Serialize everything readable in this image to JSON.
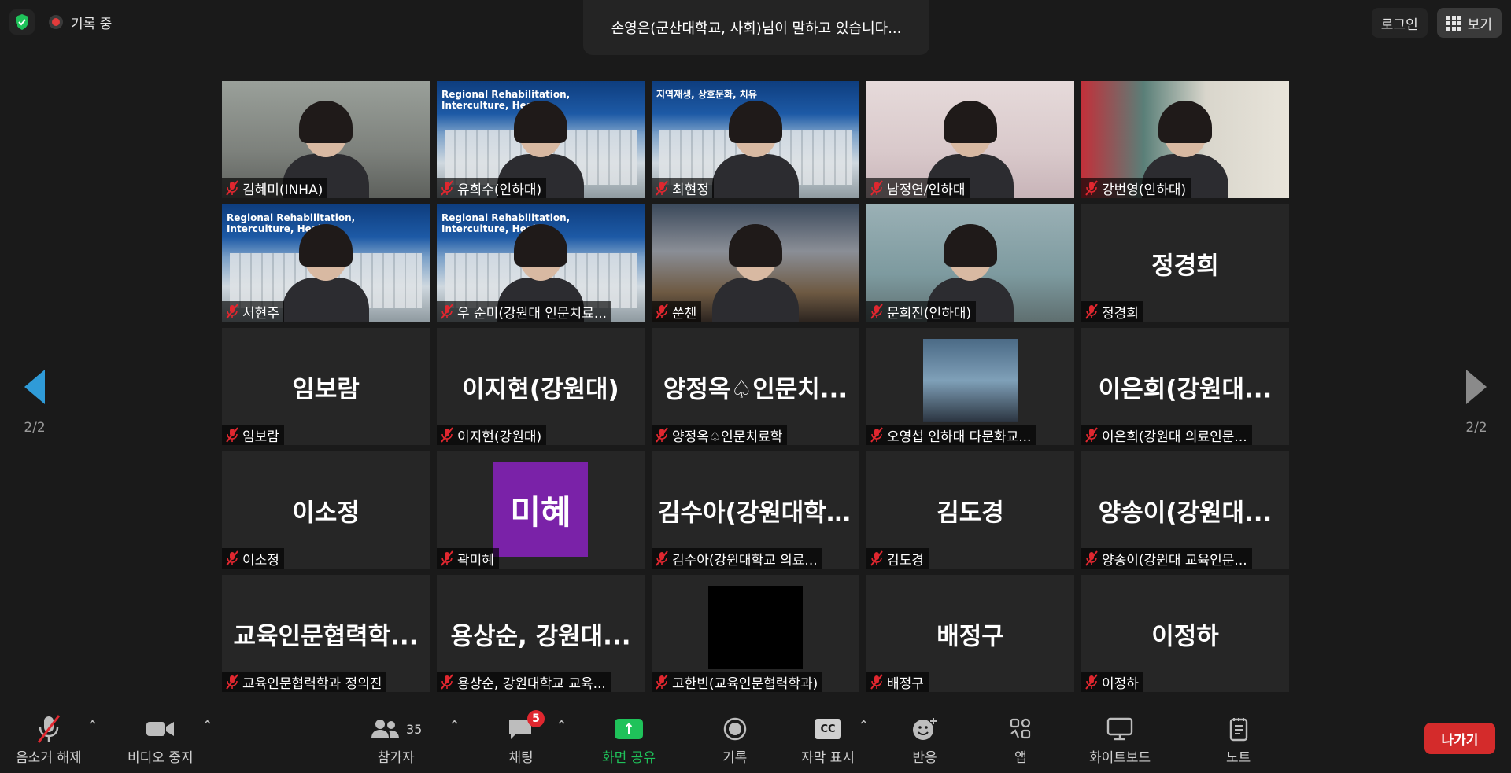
{
  "top": {
    "recording_label": "기록 중",
    "speaking_notice": "손영은(군산대학교, 사회)님이 말하고 있습니다...",
    "login_label": "로그인",
    "view_label": "보기"
  },
  "pagination": {
    "left": "2/2",
    "right": "2/2"
  },
  "tiles": [
    {
      "name": "김혜미(INHA)",
      "big": ""
    },
    {
      "name": "유희수(인하대)",
      "big": "",
      "slide": "Regional Rehabilitation,\nInterculture, Healing"
    },
    {
      "name": "최현정",
      "big": "",
      "slide": "지역재생, 상호문화, 치유"
    },
    {
      "name": "남정연/인하대",
      "big": ""
    },
    {
      "name": "강번영(인하대)",
      "big": ""
    },
    {
      "name": "서현주",
      "big": "",
      "slide": "Regional Rehabilitation,\nInterculture, Healing"
    },
    {
      "name": "우 순미(강원대 인문치료...",
      "big": "",
      "slide": "Regional Rehabilitation,\nInterculture, Healing"
    },
    {
      "name": "쑨첸",
      "big": ""
    },
    {
      "name": "문희진(인하대)",
      "big": ""
    },
    {
      "name": "정경희",
      "big": "정경희"
    },
    {
      "name": "임보람",
      "big": "임보람"
    },
    {
      "name": "이지현(강원대)",
      "big": "이지현(강원대)"
    },
    {
      "name": "양정옥♤인문치료학",
      "big": "양정옥♤인문치..."
    },
    {
      "name": "오영섭 인하대 다문화교...",
      "big": ""
    },
    {
      "name": "이은희(강원대 의료인문...",
      "big": "이은희(강원대..."
    },
    {
      "name": "이소정",
      "big": "이소정"
    },
    {
      "name": "곽미혜",
      "big": "",
      "avatar": "미혜"
    },
    {
      "name": "김수아(강원대학교 의료...",
      "big": "김수아(강원대학..."
    },
    {
      "name": "김도경",
      "big": "김도경"
    },
    {
      "name": "양송이(강원대 교육인문...",
      "big": "양송이(강원대..."
    },
    {
      "name": "교육인문협력학과 정의진",
      "big": "교육인문협력학..."
    },
    {
      "name": "용상순, 강원대학교 교육...",
      "big": "용상순, 강원대..."
    },
    {
      "name": "고한빈(교육인문협력학과)",
      "big": ""
    },
    {
      "name": "배정구",
      "big": "배정구"
    },
    {
      "name": "이정하",
      "big": "이정하"
    }
  ],
  "toolbar": {
    "unmute": "음소거 해제",
    "stop_video": "비디오 중지",
    "participants": "참가자",
    "participants_count": "35",
    "chat": "채팅",
    "chat_badge": "5",
    "share_screen": "화면 공유",
    "record": "기록",
    "captions": "자막 표시",
    "captions_icon": "CC",
    "reactions": "반응",
    "apps": "앱",
    "whiteboard": "화이트보드",
    "notes": "노트",
    "leave": "나가기"
  },
  "colors": {
    "share_green": "#1fc25a",
    "leave_red": "#d42b2b",
    "nav_blue": "#2f9bd8",
    "badge_red": "#e0272f"
  }
}
